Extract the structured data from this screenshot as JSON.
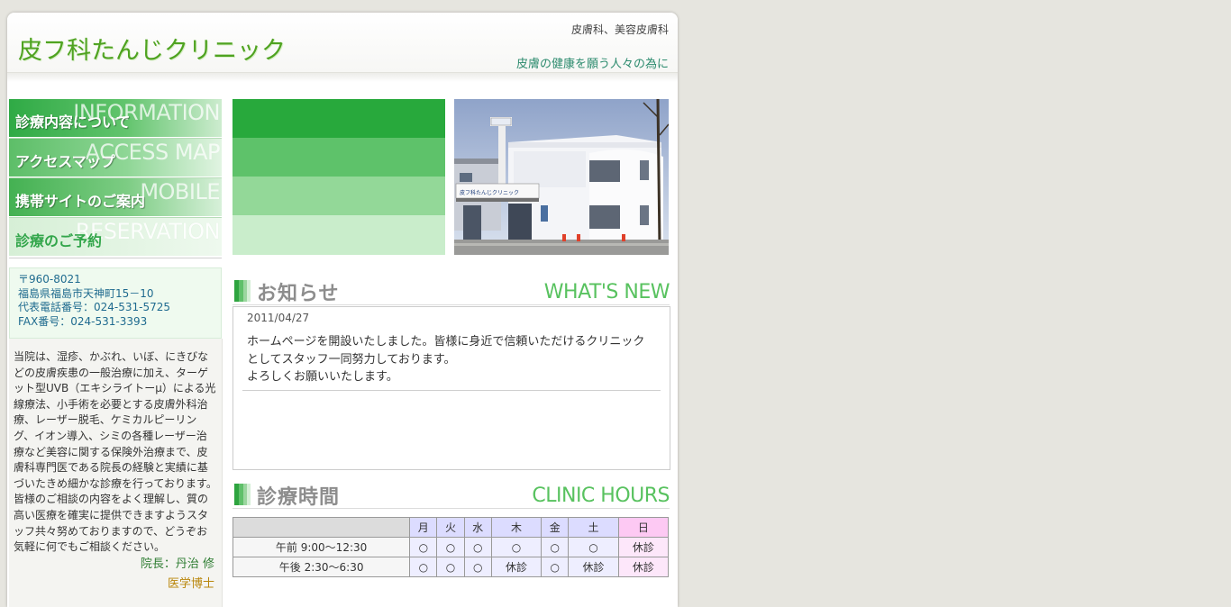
{
  "header": {
    "logo": "皮フ科たんじクリニック",
    "tagline_top": "皮膚科、美容皮膚科",
    "tagline_bottom": "皮膚の健康を願う人々の為に"
  },
  "nav": [
    {
      "label": "診療内容について",
      "en": "INFORMATION"
    },
    {
      "label": "アクセスマップ",
      "en": "ACCESS MAP"
    },
    {
      "label": "携帯サイトのご案内",
      "en": "MOBILE"
    },
    {
      "label": "診療のご予約",
      "en": "RESERVATION"
    }
  ],
  "address": {
    "zip": "〒960-8021",
    "line": "福島県福島市天神町15－10",
    "tel": "代表電話番号：024-531-5725",
    "fax": "FAX番号：024-531-3393"
  },
  "intro": {
    "text": "当院は、湿疹、かぶれ、いぼ、にきびなどの皮膚疾患の一般治療に加え、ターゲット型UVB（エキシライトーμ）による光線療法、小手術を必要とする皮膚外科治療、レーザー脱毛、ケミカルピーリング、イオン導入、シミの各種レーザー治療など美容に関する保険外治療まで、皮膚科専門医である院長の経験と実績に基づいたきめ細かな診療を行っております。皆様のご相談の内容をよく理解し、質の高い医療を確実に提供できますようスタッフ共々努めておりますので、どうぞお気軽に何でもご相談ください。",
    "director": "院長：丹治 修",
    "director_title": "医学博士"
  },
  "building_sign": "皮フ科たんじクリニック",
  "news_section": {
    "title_jp": "お知らせ",
    "title_en": "WHAT'S NEW",
    "date": "2011/04/27",
    "line1": "ホームページを開設いたしました。皆様に身近で信頼いただけるクリニック",
    "line2": "としてスタッフ一同努力しております。",
    "line3": "よろしくお願いいたします。"
  },
  "hours_section": {
    "title_jp": "診療時間",
    "title_en": "CLINIC HOURS",
    "days": [
      "月",
      "火",
      "水",
      "木",
      "金",
      "土",
      "日"
    ],
    "rows": [
      {
        "label": "午前 9:00～12:30",
        "cells": [
          "○",
          "○",
          "○",
          "○",
          "○",
          "○",
          "休診"
        ]
      },
      {
        "label": "午後 2:30～6:30",
        "cells": [
          "○",
          "○",
          "○",
          "休診",
          "○",
          "休診",
          "休診"
        ]
      }
    ]
  },
  "colors": {
    "brand_green": "#4fa321",
    "accent_teal": "#2c8b6e",
    "heading_green": "#58c25f",
    "sunday_pink": "#fdc9f3"
  }
}
